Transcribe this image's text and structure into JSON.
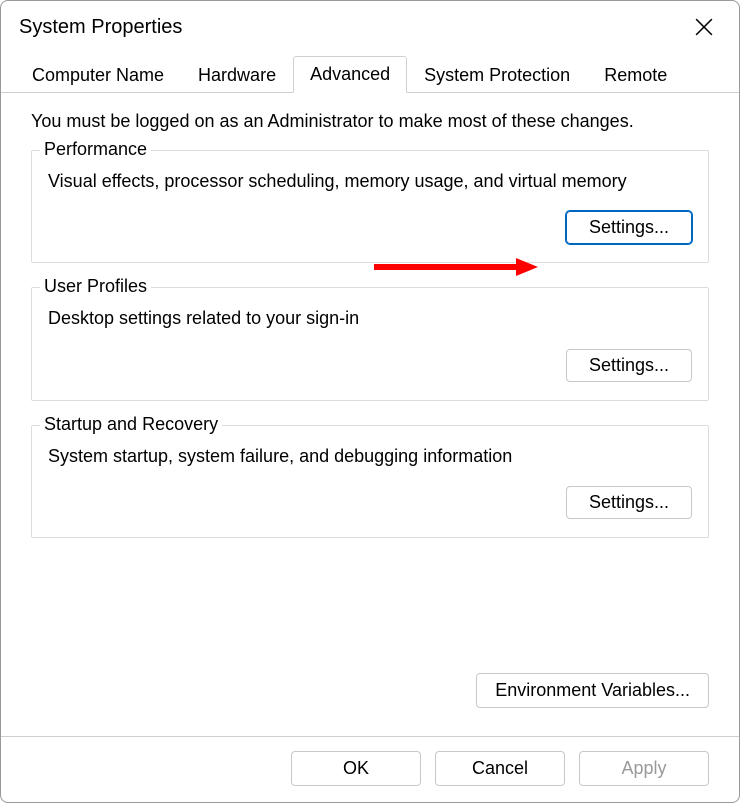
{
  "window": {
    "title": "System Properties"
  },
  "tabs": {
    "computer_name": "Computer Name",
    "hardware": "Hardware",
    "advanced": "Advanced",
    "system_protection": "System Protection",
    "remote": "Remote"
  },
  "content": {
    "intro": "You must be logged on as an Administrator to make most of these changes.",
    "performance": {
      "legend": "Performance",
      "desc": "Visual effects, processor scheduling, memory usage, and virtual memory",
      "button": "Settings..."
    },
    "user_profiles": {
      "legend": "User Profiles",
      "desc": "Desktop settings related to your sign-in",
      "button": "Settings..."
    },
    "startup_recovery": {
      "legend": "Startup and Recovery",
      "desc": "System startup, system failure, and debugging information",
      "button": "Settings..."
    },
    "env_button": "Environment Variables..."
  },
  "footer": {
    "ok": "OK",
    "cancel": "Cancel",
    "apply": "Apply"
  }
}
